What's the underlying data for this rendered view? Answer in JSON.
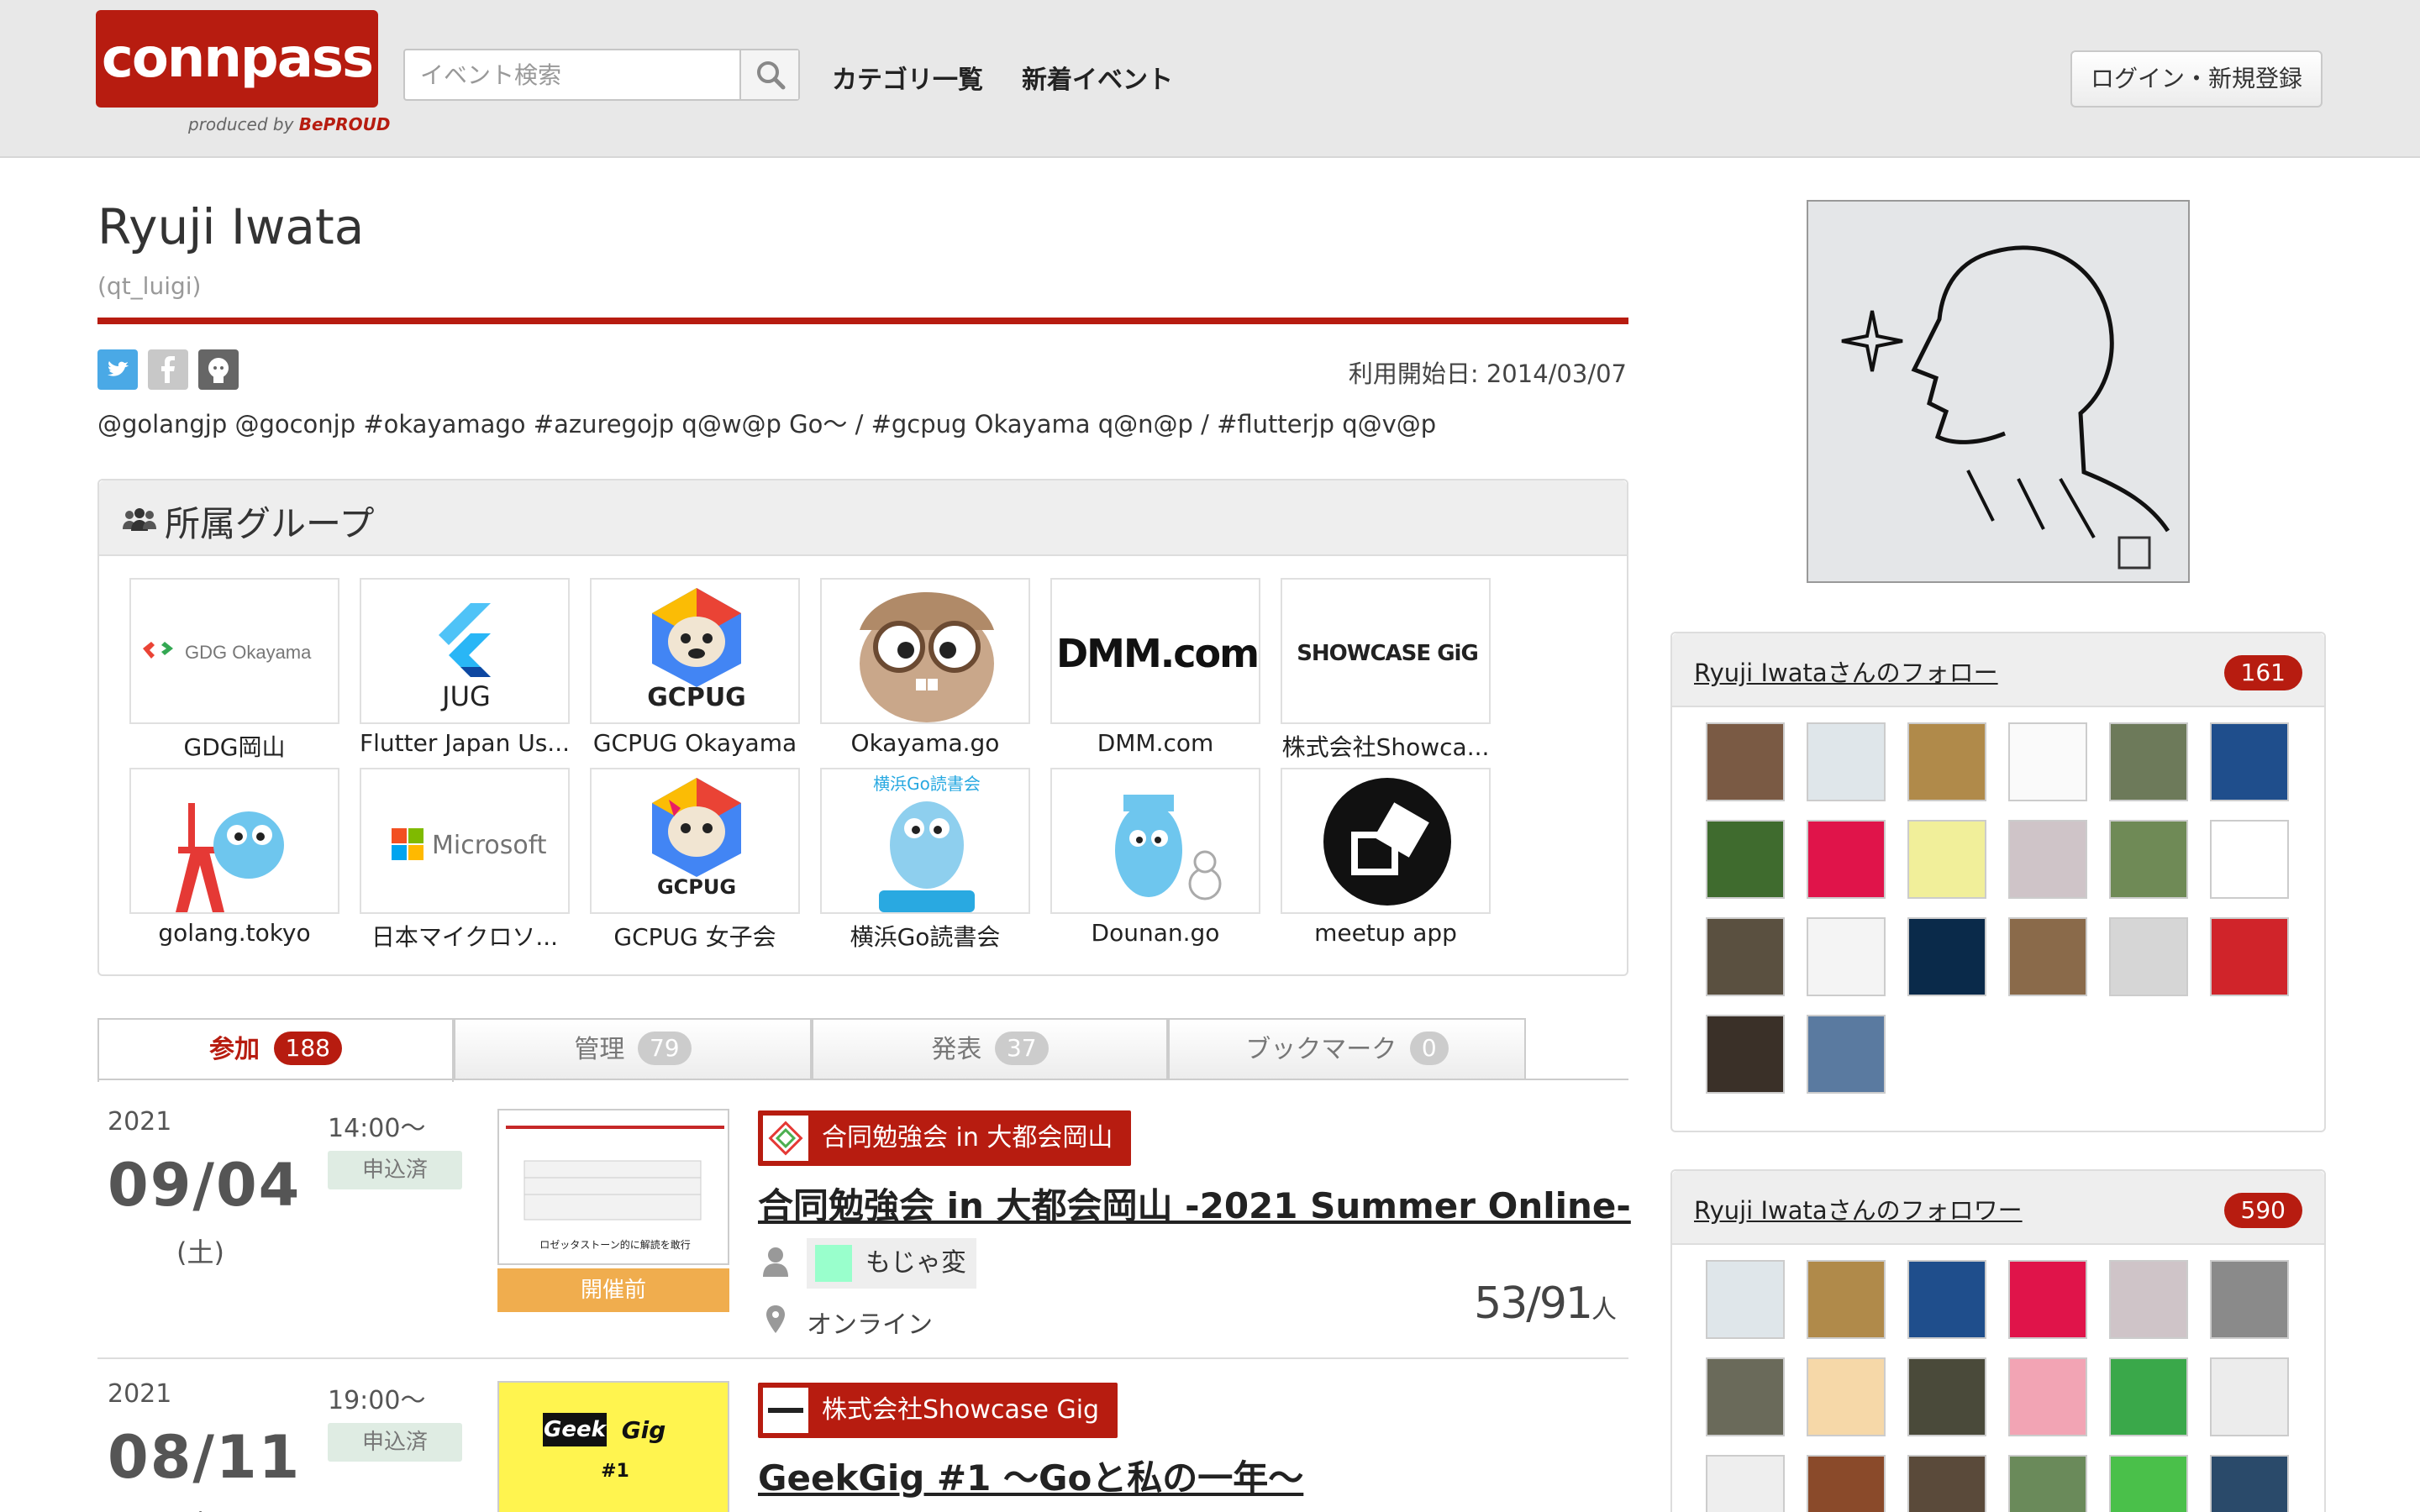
{
  "header": {
    "logo_text": "connpass",
    "logo_sub_prefix": "produced by",
    "logo_sub_brand": "BePROUD",
    "search_placeholder": "イベント検索",
    "nav": [
      "カテゴリ一覧",
      "新着イベント"
    ],
    "login_label": "ログイン・新規登録"
  },
  "profile": {
    "name": "Ryuji Iwata",
    "username": "(qt_luigi)",
    "since": "利用開始日: 2014/03/07",
    "bio": "@golangjp @goconjp #okayamago #azuregojp q@w@p Go〜 / #gcpug Okayama q@n@p / #flutterjp q@v@p",
    "social": [
      "twitter-icon",
      "facebook-icon",
      "github-icon"
    ]
  },
  "groups": {
    "title": "所属グループ",
    "items": [
      {
        "name": "GDG岡山",
        "logo": "GDG Okayama"
      },
      {
        "name": "Flutter Japan Us...",
        "logo": "JUG"
      },
      {
        "name": "GCPUG Okayama",
        "logo": "GCPUG"
      },
      {
        "name": "Okayama.go",
        "logo": ""
      },
      {
        "name": "DMM.com",
        "logo": "DMM.com"
      },
      {
        "name": "株式会社Showca...",
        "logo": "SHOWCASE GiG"
      },
      {
        "name": "golang.tokyo",
        "logo": ""
      },
      {
        "name": "日本マイクロソ...",
        "logo": "Microsoft"
      },
      {
        "name": "GCPUG 女子会",
        "logo": "GCPUG"
      },
      {
        "name": "横浜Go読書会",
        "logo": "横浜Go読書会"
      },
      {
        "name": "Dounan.go",
        "logo": ""
      },
      {
        "name": "meetup app",
        "logo": ""
      }
    ]
  },
  "tabs": [
    {
      "label": "参加",
      "count": "188"
    },
    {
      "label": "管理",
      "count": "79"
    },
    {
      "label": "発表",
      "count": "37"
    },
    {
      "label": "ブックマーク",
      "count": "0"
    }
  ],
  "events": [
    {
      "year": "2021",
      "date": "09/04",
      "dow": "(土)",
      "time": "14:00〜",
      "status": "申込済",
      "phase": "開催前",
      "group": "合同勉強会 in 大都会岡山",
      "title": "合同勉強会 in 大都会岡山 -2021 Summer Online-",
      "owner": "もじゃ変",
      "place": "オンライン",
      "count": "53/91",
      "unit": "人",
      "thumb_label": "ロゼッタストーン的に解読を敢行"
    },
    {
      "year": "2021",
      "date": "08/11",
      "dow": "(水)",
      "time": "19:00〜",
      "status": "申込済",
      "group": "株式会社Showcase Gig",
      "title": "GeekGig #1 〜Goと私の一年〜",
      "thumb_label": "Geek Gig"
    }
  ],
  "sidebar": {
    "following_title": "Ryuji Iwataさんのフォロー",
    "following_count": "161",
    "followers_title": "Ryuji Iwataさんのフォロワー",
    "followers_count": "590"
  },
  "colors": {
    "brand": "#b71c10",
    "phase": "#f0ad4e",
    "status_bg": "#dfece3"
  }
}
